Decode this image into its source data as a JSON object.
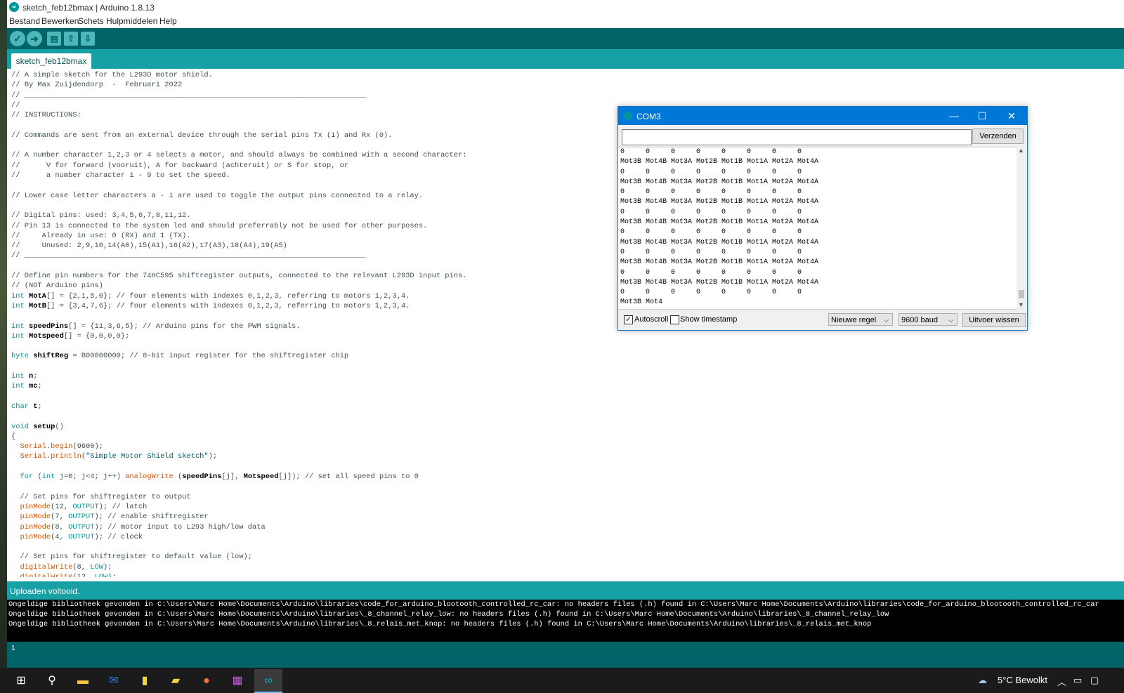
{
  "window": {
    "title": "sketch_feb12bmax | Arduino 1.8.13",
    "icon": "arduino-icon"
  },
  "menu": [
    "Bestand",
    "Bewerken",
    "Schets",
    "Hulpmiddelen",
    "Help"
  ],
  "toolbar": [
    "verify-icon",
    "upload-icon",
    "new-icon",
    "open-icon",
    "save-icon"
  ],
  "tab": {
    "label": "sketch_feb12bmax"
  },
  "code": [
    [
      [
        "c",
        "// A simple sketch for the L293D motor shield."
      ]
    ],
    [
      [
        "c",
        "// By Max Zuijdendorp  -  Februari 2022"
      ]
    ],
    [
      [
        "c",
        "// ______________________________________________________________________________"
      ]
    ],
    [
      [
        "c",
        "//"
      ]
    ],
    [
      [
        "c",
        "// INSTRUCTIONS:"
      ]
    ],
    [],
    [
      [
        "c",
        "// Commands are sent from an external device through the serial pins Tx (1) and Rx (0)."
      ]
    ],
    [],
    [
      [
        "c",
        "// A number character 1,2,3 or 4 selects a motor, and should always be combined with a second character:"
      ]
    ],
    [
      [
        "c",
        "//      V for forward (vooruit), A for backward (achteruit) or S for stop, or"
      ]
    ],
    [
      [
        "c",
        "//      a number character 1 - 9 to set the speed."
      ]
    ],
    [],
    [
      [
        "c",
        "// Lower case letter characters a - i are used to toggle the output pins connected to a relay."
      ]
    ],
    [],
    [
      [
        "c",
        "// Digital pins: used: 3,4,5,6,7,8,11,12."
      ]
    ],
    [
      [
        "c",
        "// Pin 13 is connected to the system led and should preferrably not be used for other purposes."
      ]
    ],
    [
      [
        "c",
        "//     Already in use: 0 (RX) and 1 (TX)."
      ]
    ],
    [
      [
        "c",
        "//     Unused: 2,9,10,14(A0),15(A1),16(A2),17(A3),18(A4),19(A5)"
      ]
    ],
    [
      [
        "c",
        "// ______________________________________________________________________________"
      ]
    ],
    [],
    [
      [
        "c",
        "// Define pin numbers for the 74HC595 shiftregister outputs, connected to the relevant L293D input pins."
      ]
    ],
    [
      [
        "c",
        "// (NOT Arduino pins)"
      ]
    ],
    [
      [
        "k",
        "int"
      ],
      [
        "c",
        " "
      ],
      [
        "b",
        "MotA"
      ],
      [
        "c",
        "[] = {2,1,5,0}; // four elements with indexes 0,1,2,3, referring to motors 1,2,3,4."
      ]
    ],
    [
      [
        "k",
        "int"
      ],
      [
        "c",
        " "
      ],
      [
        "b",
        "MotB"
      ],
      [
        "c",
        "[] = {3,4,7,6}; // four elements with indexes 0,1,2,3, referring to motors 1,2,3,4."
      ]
    ],
    [],
    [
      [
        "k",
        "int"
      ],
      [
        "c",
        " "
      ],
      [
        "b",
        "speedPins"
      ],
      [
        "c",
        "[] = {11,3,6,5}; // Arduino pins for the PWM signals."
      ]
    ],
    [
      [
        "k",
        "int"
      ],
      [
        "c",
        " "
      ],
      [
        "b",
        "Motspeed"
      ],
      [
        "c",
        "[] = {0,0,0,0};"
      ]
    ],
    [],
    [
      [
        "k",
        "byte"
      ],
      [
        "c",
        " "
      ],
      [
        "b",
        "shiftReg"
      ],
      [
        "c",
        " = B00000000; // 8-bit input register for the shiftregister chip"
      ]
    ],
    [],
    [
      [
        "k",
        "int"
      ],
      [
        "c",
        " "
      ],
      [
        "b",
        "n"
      ],
      [
        "c",
        ";"
      ]
    ],
    [
      [
        "k",
        "int"
      ],
      [
        "c",
        " "
      ],
      [
        "b",
        "mc"
      ],
      [
        "c",
        ";"
      ]
    ],
    [],
    [
      [
        "k",
        "char"
      ],
      [
        "c",
        " "
      ],
      [
        "b",
        "t"
      ],
      [
        "c",
        ";"
      ]
    ],
    [],
    [
      [
        "k",
        "void"
      ],
      [
        "c",
        " "
      ],
      [
        "b",
        "setup"
      ],
      [
        "c",
        "()"
      ]
    ],
    [
      [
        "c",
        "{"
      ]
    ],
    [
      [
        "c",
        "  "
      ],
      [
        "f",
        "Serial"
      ],
      [
        "c",
        "."
      ],
      [
        "f",
        "begin"
      ],
      [
        "c",
        "(9600);"
      ]
    ],
    [
      [
        "c",
        "  "
      ],
      [
        "f",
        "Serial"
      ],
      [
        "c",
        "."
      ],
      [
        "f",
        "println"
      ],
      [
        "c",
        "("
      ],
      [
        "s",
        "\"Simple Motor Shield sketch\""
      ],
      [
        "c",
        ");"
      ]
    ],
    [],
    [
      [
        "c",
        "  "
      ],
      [
        "k",
        "for"
      ],
      [
        "c",
        " ("
      ],
      [
        "k",
        "int"
      ],
      [
        "c",
        " j=0; j<4; j++) "
      ],
      [
        "f",
        "analogWrite"
      ],
      [
        "c",
        " ("
      ],
      [
        "b",
        "speedPins"
      ],
      [
        "c",
        "[j], "
      ],
      [
        "b",
        "Motspeed"
      ],
      [
        "c",
        "[j]); // set all speed pins to 0"
      ]
    ],
    [],
    [
      [
        "c",
        "  // Set pins for shiftregister to output"
      ]
    ],
    [
      [
        "c",
        "  "
      ],
      [
        "f",
        "pinMode"
      ],
      [
        "c",
        "(12, "
      ],
      [
        "k",
        "OUTPUT"
      ],
      [
        "c",
        "); // latch"
      ]
    ],
    [
      [
        "c",
        "  "
      ],
      [
        "f",
        "pinMode"
      ],
      [
        "c",
        "(7, "
      ],
      [
        "k",
        "OUTPUT"
      ],
      [
        "c",
        "); // enable shiftregister"
      ]
    ],
    [
      [
        "c",
        "  "
      ],
      [
        "f",
        "pinMode"
      ],
      [
        "c",
        "(8, "
      ],
      [
        "k",
        "OUTPUT"
      ],
      [
        "c",
        "); // motor input to L293 high/low data"
      ]
    ],
    [
      [
        "c",
        "  "
      ],
      [
        "f",
        "pinMode"
      ],
      [
        "c",
        "(4, "
      ],
      [
        "k",
        "OUTPUT"
      ],
      [
        "c",
        "); // clock"
      ]
    ],
    [],
    [
      [
        "c",
        "  // Set pins for shiftregister to default value (low);"
      ]
    ],
    [
      [
        "c",
        "  "
      ],
      [
        "f",
        "digitalWrite"
      ],
      [
        "c",
        "(8, "
      ],
      [
        "k",
        "LOW"
      ],
      [
        "c",
        ");"
      ]
    ],
    [
      [
        "c",
        "  "
      ],
      [
        "f",
        "digitalWrite"
      ],
      [
        "c",
        "(12, "
      ],
      [
        "k",
        "LOW"
      ],
      [
        "c",
        ");"
      ]
    ]
  ],
  "status": {
    "message": "Uploaden voltooid."
  },
  "console": [
    "Ongeldige bibliotheek gevonden in C:\\Users\\Marc Home\\Documents\\Arduino\\libraries\\code_for_arduino_blootooth_controlled_rc_car: no headers files (.h) found in C:\\Users\\Marc Home\\Documents\\Arduino\\libraries\\code_for_arduino_blootooth_controlled_rc_car",
    "Ongeldige bibliotheek gevonden in C:\\Users\\Marc Home\\Documents\\Arduino\\libraries\\_8_channel_relay_low: no headers files (.h) found in C:\\Users\\Marc Home\\Documents\\Arduino\\libraries\\_8_channel_relay_low",
    "Ongeldige bibliotheek gevonden in C:\\Users\\Marc Home\\Documents\\Arduino\\libraries\\_8_relais_met_knop: no headers files (.h) found in C:\\Users\\Marc Home\\Documents\\Arduino\\libraries\\_8_relais_met_knop"
  ],
  "line_number": "1",
  "serial_monitor": {
    "title": "COM3",
    "input_value": "",
    "send_label": "Verzenden",
    "output": [
      "0     0     0     0     0     0     0     0",
      "Mot3B Mot4B Mot3A Mot2B Mot1B Mot1A Mot2A Mot4A",
      "0     0     0     0     0     0     0     0",
      "Mot3B Mot4B Mot3A Mot2B Mot1B Mot1A Mot2A Mot4A",
      "0     0     0     0     0     0     0     0",
      "Mot3B Mot4B Mot3A Mot2B Mot1B Mot1A Mot2A Mot4A",
      "0     0     0     0     0     0     0     0",
      "Mot3B Mot4B Mot3A Mot2B Mot1B Mot1A Mot2A Mot4A",
      "0     0     0     0     0     0     0     0",
      "Mot3B Mot4B Mot3A Mot2B Mot1B Mot1A Mot2A Mot4A",
      "0     0     0     0     0     0     0     0",
      "Mot3B Mot4B Mot3A Mot2B Mot1B Mot1A Mot2A Mot4A",
      "0     0     0     0     0     0     0     0",
      "Mot3B Mot4B Mot3A Mot2B Mot1B Mot1A Mot2A Mot4A",
      "0     0     0     0     0     0     0     0",
      "Mot3B Mot4"
    ],
    "autoscroll": {
      "label": "Autoscroll",
      "checked": true
    },
    "timestamp": {
      "label": "Show timestamp",
      "checked": false
    },
    "line_ending": "Nieuwe regel",
    "baud": "9600 baud",
    "clear_label": "Uitvoer wissen"
  },
  "taskbar": {
    "icons": [
      "windows-start-icon",
      "search-icon",
      "file-explorer-icon",
      "outlook-icon",
      "sticky-notes-icon",
      "file-icon",
      "firefox-icon",
      "winrar-icon",
      "arduino-icon"
    ],
    "active": "arduino-icon",
    "weather": "5°C  Bewolkt"
  },
  "colors": {
    "teal_dark": "#006468",
    "teal": "#17a1a5",
    "keyword": "#00979c",
    "function": "#d35400"
  }
}
